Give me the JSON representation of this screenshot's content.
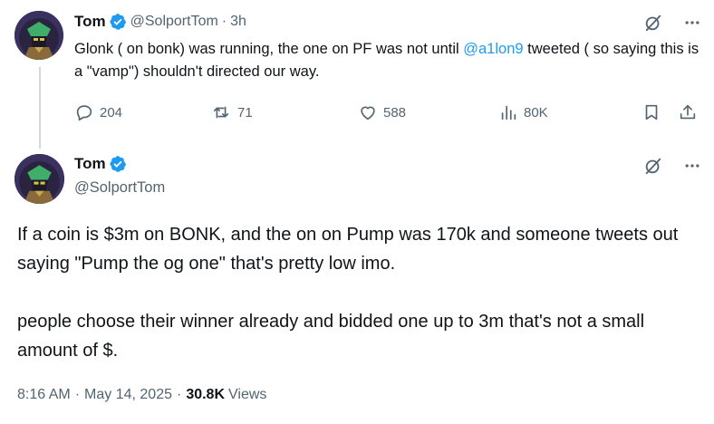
{
  "reply_tweet": {
    "author_name": "Tom",
    "handle": "@SolportTom",
    "separator": "·",
    "time_ago": "3h",
    "text_before_mention": "Glonk ( on bonk) was running, the one on PF was not until ",
    "mention": "@a1lon9",
    "text_after_mention": " tweeted ( so saying this is a \"vamp\") shouldn't directed our way.",
    "actions": {
      "replies": "204",
      "reposts": "71",
      "likes": "588",
      "views": "80K"
    }
  },
  "main_tweet": {
    "author_name": "Tom",
    "handle": "@SolportTom",
    "paragraph_1": "If a coin is $3m on BONK, and the on on Pump was 170k and someone tweets out saying \"Pump the og one\" that's pretty low imo.",
    "paragraph_2": "people choose their winner already and bidded one up to 3m that's not a small amount of $.",
    "timestamp": "8:16 AM",
    "date": "May 14, 2025",
    "views_count": "30.8K",
    "views_label": "Views",
    "separator": "·"
  },
  "colors": {
    "text": "#0f1419",
    "secondary": "#536471",
    "accent": "#1d9bf0",
    "thread_line": "#cfd9de"
  },
  "icons": [
    "verified-badge-icon",
    "grok-icon",
    "more-icon",
    "reply-icon",
    "repost-icon",
    "like-icon",
    "views-icon",
    "bookmark-icon",
    "share-icon"
  ]
}
